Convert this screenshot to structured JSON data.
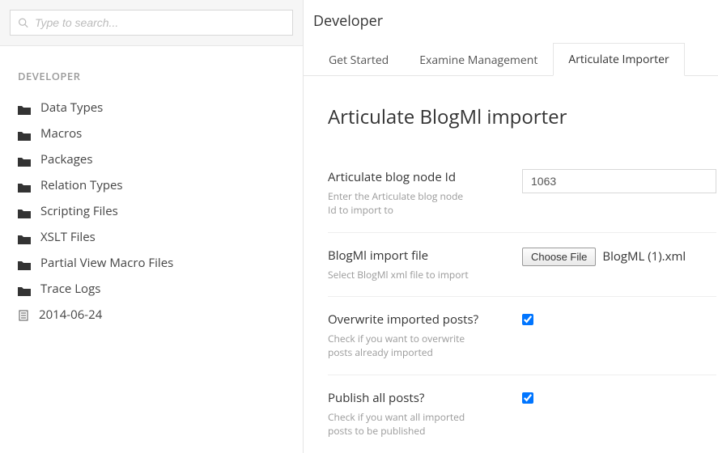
{
  "search": {
    "placeholder": "Type to search..."
  },
  "sidebar": {
    "section_title": "DEVELOPER",
    "items": [
      {
        "label": "Data Types"
      },
      {
        "label": "Macros"
      },
      {
        "label": "Packages"
      },
      {
        "label": "Relation Types"
      },
      {
        "label": "Scripting Files"
      },
      {
        "label": "XSLT Files"
      },
      {
        "label": "Partial View Macro Files"
      },
      {
        "label": "Trace Logs",
        "children": [
          {
            "label": "2014-06-24"
          }
        ]
      }
    ]
  },
  "header": {
    "title": "Developer"
  },
  "tabs": [
    {
      "label": "Get Started",
      "active": false
    },
    {
      "label": "Examine Management",
      "active": false
    },
    {
      "label": "Articulate Importer",
      "active": true
    }
  ],
  "page": {
    "heading": "Articulate BlogMl importer",
    "fields": {
      "node_id": {
        "label": "Articulate blog node Id",
        "help": "Enter the Articulate blog node Id to import to",
        "value": "1063"
      },
      "import_file": {
        "label": "BlogMl import file",
        "help": "Select BlogMl xml file to import",
        "button": "Choose File",
        "filename": "BlogML (1).xml"
      },
      "overwrite": {
        "label": "Overwrite imported posts?",
        "help": "Check if you want to overwrite posts already imported",
        "checked": true
      },
      "publish": {
        "label": "Publish all posts?",
        "help": "Check if you want all imported posts to be published",
        "checked": true
      }
    }
  }
}
